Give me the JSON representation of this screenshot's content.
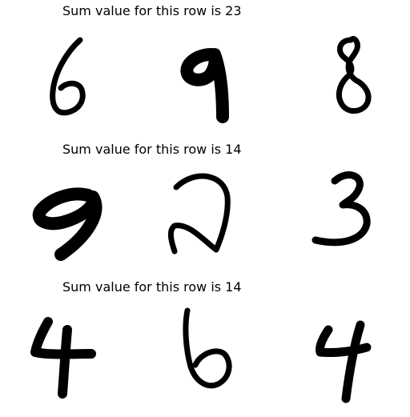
{
  "rows": [
    {
      "title": "Sum value for this row is 23",
      "digits": [
        6,
        9,
        8
      ]
    },
    {
      "title": "Sum value for this row is 14",
      "digits": [
        9,
        2,
        3
      ]
    },
    {
      "title": "Sum value for this row is 14",
      "digits": [
        4,
        6,
        4
      ]
    }
  ],
  "colors": {
    "ink": "#000000",
    "background": "#ffffff"
  }
}
